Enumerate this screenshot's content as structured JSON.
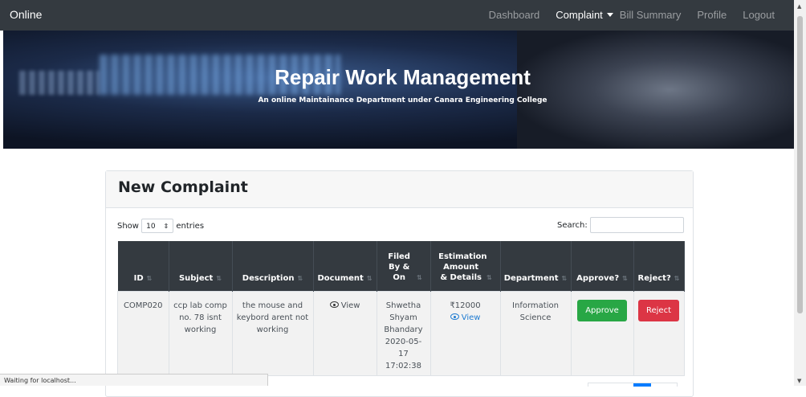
{
  "navbar": {
    "brand": "Online",
    "items": {
      "dashboard": "Dashboard",
      "complaint": "Complaint",
      "bill_summary": "Bill Summary",
      "profile": "Profile",
      "logout": "Logout"
    }
  },
  "hero": {
    "title": "Repair Work Management",
    "subtitle": "An online Maintainance Department under Canara Engineering College"
  },
  "card": {
    "title": "New Complaint",
    "show_label": "Show",
    "entries_value": "10",
    "entries_label": "entries",
    "search_label": "Search:"
  },
  "table": {
    "headers": {
      "id": "ID",
      "subject": "Subject",
      "description": "Description",
      "document": "Document",
      "filed": "Filed By & On",
      "estimation": "Estimation Amount & Details",
      "department": "Department",
      "approve": "Approve?",
      "reject": "Reject?"
    },
    "rows": [
      {
        "id": "COMP020",
        "subject": "ccp lab comp no. 78 isnt working",
        "description": "the mouse and keybord arent not working",
        "document": "View",
        "filed_by": "Shwetha Shyam Bhandary",
        "filed_on": "2020-05-17 17:02:38",
        "amount": "₹12000",
        "details": "View",
        "department": "Information Science",
        "approve": "Approve",
        "reject": "Reject"
      }
    ]
  },
  "status_bar": "Waiting for localhost...",
  "colors": {
    "navbar": "#343a40",
    "approve": "#28a745",
    "reject": "#dc3545",
    "link": "#1e7bd1"
  }
}
